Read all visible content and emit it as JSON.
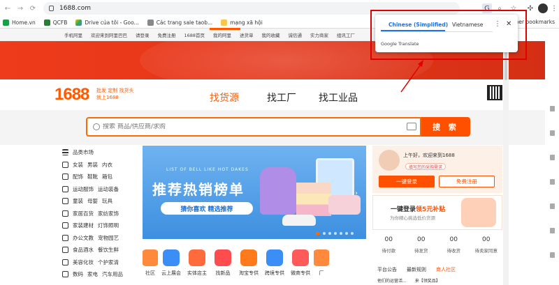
{
  "browser": {
    "url": "1688.com"
  },
  "bookmarks": [
    "Home.vn",
    "QCFB",
    "Drive của tôi - Goo...",
    "Các trang sale taob...",
    "mạng xã hội"
  ],
  "bookmarks_other": "Other bookmarks",
  "site_bar": [
    "手机阿里",
    "欢迎来到阿里巴巴",
    "请登录",
    "免费注册",
    "1688首页",
    "我的阿里",
    "进货单",
    "我的收藏",
    "诚信通",
    "实力商家",
    "组讯工厂"
  ],
  "translate_popup": {
    "tab_source": "Chinese (Simplified)",
    "tab_target": "Vietnamese",
    "brand": "Google Translate",
    "menu": "⋮",
    "close": "✕"
  },
  "header": {
    "logo": "1688",
    "slogan": "批发 定制 找货头 就上1688",
    "tabs": [
      "找货源",
      "找工厂",
      "找工业品"
    ]
  },
  "search": {
    "placeholder": "搜索 商品/供应商/求购",
    "button": "搜 索"
  },
  "categories": {
    "title": "品类市场",
    "rows": [
      [
        "女装",
        "男装",
        "内衣"
      ],
      [
        "配饰",
        "鞋靴",
        "箱包"
      ],
      [
        "运动服饰",
        "运动装备"
      ],
      [
        "童装",
        "母婴",
        "玩具"
      ],
      [
        "家居百货",
        "家纺家饰"
      ],
      [
        "家装建材",
        "灯饰照明"
      ],
      [
        "办公文教",
        "宠物园艺"
      ],
      [
        "食品酒水",
        "餐饮生鲜"
      ],
      [
        "美容化妆",
        "个护家清"
      ],
      [
        "数码",
        "家电",
        "汽车用品"
      ]
    ]
  },
  "carousel": {
    "tag": "LIST OF BELL LIKE HOT DAKES",
    "title": "推荐热销榜单",
    "subtitle": "猜你喜欢 精选推荐",
    "next": "›"
  },
  "quick_cats": [
    "社区",
    "云上展会",
    "实体店主",
    "找新品",
    "淘宝专供",
    "跨境专供",
    "微商专供",
    "厂"
  ],
  "quick_cat_colors": [
    "#ff8a3d",
    "#3a8ef6",
    "#ff6b3d",
    "#ff4d4f",
    "#ff7a1a",
    "#3a8ef6",
    "#ff5a5a",
    "#ff8a3d"
  ],
  "user": {
    "greeting": "上午好，欢迎来到1688",
    "tip": "填写您的采购需求",
    "login": "一键登录",
    "register": "免费注册"
  },
  "promo": {
    "title_a": "一键登录",
    "title_b": "领5元补贴",
    "sub": "为你精心挑选低价货源"
  },
  "orders": [
    {
      "n": "00",
      "t": "待付款"
    },
    {
      "n": "00",
      "t": "待发货"
    },
    {
      "n": "00",
      "t": "待收货"
    },
    {
      "n": "00",
      "t": "待卖家同意"
    }
  ],
  "news_tabs": [
    "平台公告",
    "最新规则",
    "商人社区"
  ],
  "news": [
    "他们的运营活...",
    "来【领奖品】"
  ]
}
